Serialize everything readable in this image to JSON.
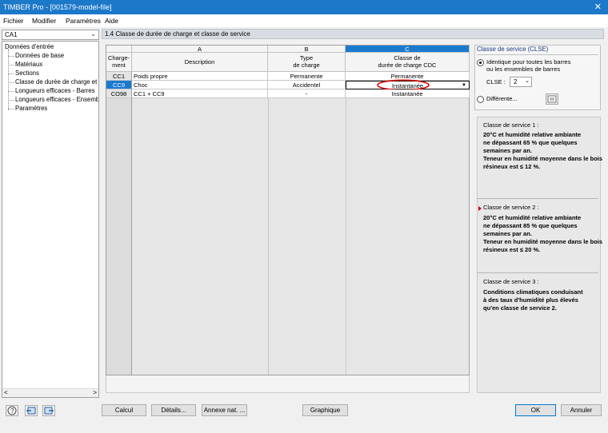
{
  "window": {
    "title": "TIMBER Pro - [001579-model-file]",
    "close_glyph": "✕"
  },
  "menu": [
    "Fichier",
    "Modifier",
    "Paramètres",
    "Aide"
  ],
  "left": {
    "case_selector": "CA1",
    "tree_root": "Données d'entrée",
    "tree_items": [
      "Données de base",
      "Matériaux",
      "Sections",
      "Classe de durée de charge et c",
      "Longueurs efficaces - Barres",
      "Longueurs efficaces - Ensemble",
      "Paramètres"
    ]
  },
  "panel": {
    "title": "1.4 Classe de durée de charge et classe de service"
  },
  "table": {
    "col_letters": [
      "A",
      "B",
      "C"
    ],
    "row_header_label": [
      "Charge-",
      "ment"
    ],
    "col_headers": {
      "description": "Description",
      "type_line1": "Type",
      "type_line2": "de charge",
      "class_line1": "Classe de",
      "class_line2": "durée de charge CDC"
    },
    "rows": [
      {
        "id": "CC1",
        "description": "Poids propre",
        "type": "Permanente",
        "class": "Permanente"
      },
      {
        "id": "CC9",
        "description": "Choc",
        "type": "Accidentel",
        "class": "Instantanée"
      },
      {
        "id": "CO98",
        "description": "CC1 + CC9",
        "type": "-",
        "class": "Instantanée"
      }
    ],
    "selected_row": 1
  },
  "service": {
    "title": "Classe de service (CLSE)",
    "identical_line1": "Identique pour toutes les barres",
    "identical_line2": "ou les ensembles de barres",
    "clse_label": "CLSE :",
    "clse_value": "2",
    "different_label": "Différente..."
  },
  "info": {
    "class1": {
      "title": "Classe de service 1 :",
      "lines": [
        "20°C et humidité relative ambiante",
        "ne dépassant 65 % que quelques",
        "semaines par an.",
        "Teneur en humidité moyenne dans le bois",
        "résineux est ≤ 12 %."
      ]
    },
    "class2": {
      "title": "Classe de service 2 :",
      "lines": [
        "20°C et humidité relative ambiante",
        "ne dépassant 85 % que quelques",
        "semaines par an.",
        "Teneur en humidité moyenne dans le bois",
        "résineux est ≤ 20 %."
      ]
    },
    "class3": {
      "title": "Classe de service 3 :",
      "lines": [
        "Conditions climatiques conduisant",
        "à des taux d'humidité plus élevés",
        "qu'en classe de service 2."
      ]
    },
    "marker_color": "#cc0000"
  },
  "buttons": {
    "calc": "Calcul",
    "details": "Détails...",
    "annex": "Annexe nat. ...",
    "graphic": "Graphique",
    "ok": "OK",
    "cancel": "Annuler"
  },
  "colors": {
    "titlebar": "#1c78c8",
    "selected_header": "#1a7ad0",
    "highlight_oval": "#d80000"
  }
}
